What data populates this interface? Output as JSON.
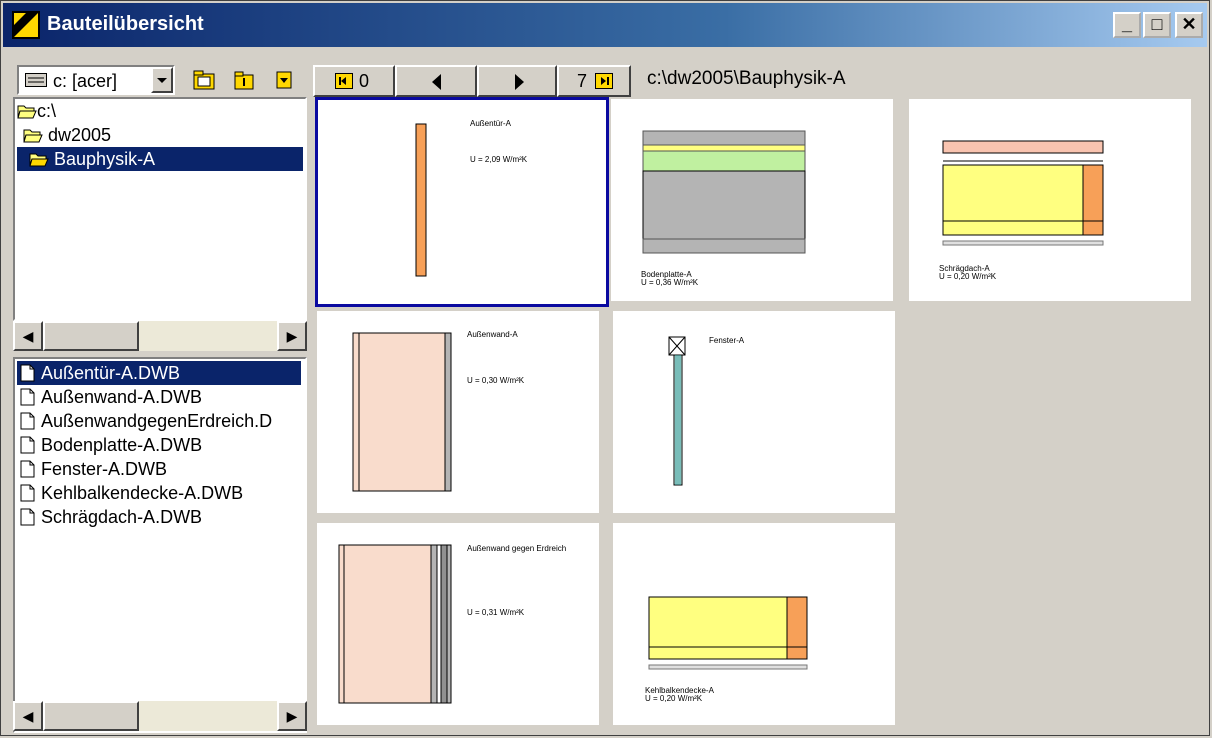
{
  "window": {
    "title": "Bauteilübersicht",
    "minimize": "_",
    "maximize": "□",
    "close": "✕"
  },
  "toolbar": {
    "drive": "c: [acer]",
    "first_label": "0",
    "last_label": "7",
    "path": "c:\\dw2005\\Bauphysik-A"
  },
  "tree": {
    "items": [
      "c:\\",
      "dw2005",
      "Bauphysik-A"
    ]
  },
  "files": {
    "items": [
      "Außentür-A.DWB",
      "Außenwand-A.DWB",
      "AußenwandgegenErdreich.D",
      "Bodenplatte-A.DWB",
      "Fenster-A.DWB",
      "Kehlbalkendecke-A.DWB",
      "Schrägdach-A.DWB"
    ]
  },
  "thumbnails": [
    {
      "name": "Außentür-A",
      "u": "U = 2,09 W/m²K"
    },
    {
      "name": "Bodenplatte-A",
      "u": "U = 0,36 W/m²K"
    },
    {
      "name": "Schrägdach-A",
      "u": "U = 0,20 W/m²K"
    },
    {
      "name": "Außenwand-A",
      "u": "U = 0,30 W/m²K"
    },
    {
      "name": "Fenster-A",
      "u": ""
    },
    {
      "name": "Außenwand gegen Erdreich",
      "u": "U = 0,31 W/m²K"
    },
    {
      "name": "Kehlbalkendecke-A",
      "u": "U = 0,20 W/m²K"
    }
  ],
  "colors": {
    "selection": "#0a246a",
    "salmon": "#f9dccc",
    "orange": "#f7a058",
    "yellow": "#ffff80",
    "green": "#c0f0a0",
    "gray": "#b4b4b4"
  }
}
